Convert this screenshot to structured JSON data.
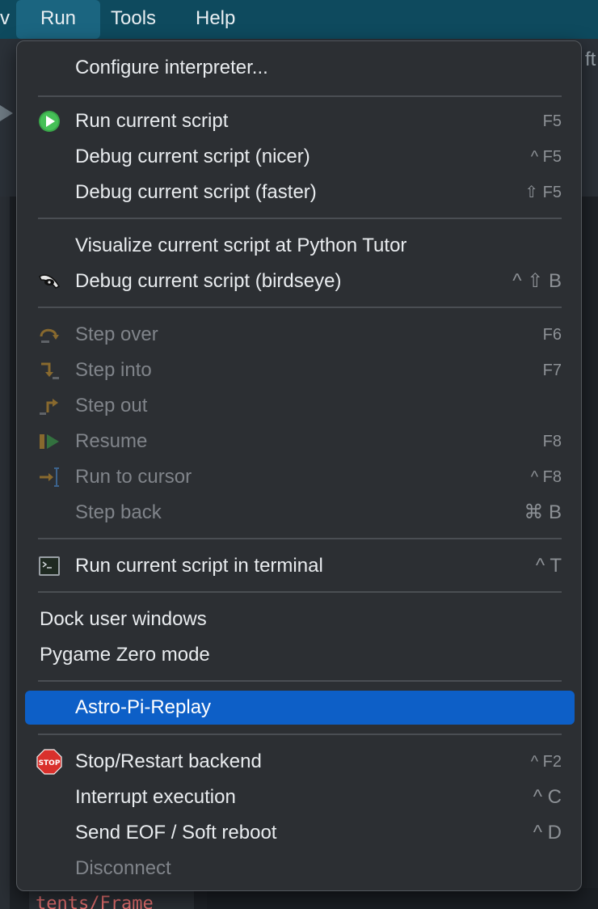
{
  "menubar": {
    "left_fragment": "v",
    "items": [
      "Run",
      "Tools",
      "Help"
    ]
  },
  "background": {
    "right_fragment": "ft",
    "code_fragment": "tents/Frame"
  },
  "menu": {
    "items": [
      {
        "label": "Configure interpreter...",
        "shortcut": "",
        "icon": "",
        "enabled": true
      },
      {
        "label": "Run current script",
        "shortcut": "F5",
        "icon": "run-icon",
        "enabled": true
      },
      {
        "label": "Debug current script (nicer)",
        "shortcut": "^ F5",
        "icon": "",
        "enabled": true
      },
      {
        "label": "Debug current script (faster)",
        "shortcut": "⇧ F5",
        "icon": "",
        "enabled": true
      },
      {
        "label": "Visualize current script at Python Tutor",
        "shortcut": "",
        "icon": "",
        "enabled": true
      },
      {
        "label": "Debug current script (birdseye)",
        "shortcut": "^ ⇧ B",
        "icon": "birdseye-icon",
        "enabled": true
      },
      {
        "label": "Step over",
        "shortcut": "F6",
        "icon": "step-over-icon",
        "enabled": false
      },
      {
        "label": "Step into",
        "shortcut": "F7",
        "icon": "step-into-icon",
        "enabled": false
      },
      {
        "label": "Step out",
        "shortcut": "",
        "icon": "step-out-icon",
        "enabled": false
      },
      {
        "label": "Resume",
        "shortcut": "F8",
        "icon": "resume-icon",
        "enabled": false
      },
      {
        "label": "Run to cursor",
        "shortcut": "^ F8",
        "icon": "run-to-cursor-icon",
        "enabled": false
      },
      {
        "label": "Step back",
        "shortcut": "⌘ B",
        "icon": "",
        "enabled": false
      },
      {
        "label": "Run current script in terminal",
        "shortcut": "^ T",
        "icon": "terminal-icon",
        "enabled": true
      },
      {
        "label": "Dock user windows",
        "shortcut": "",
        "icon": "",
        "enabled": true
      },
      {
        "label": "Pygame Zero mode",
        "shortcut": "",
        "icon": "",
        "enabled": true
      },
      {
        "label": "Astro-Pi-Replay",
        "shortcut": "",
        "icon": "",
        "enabled": true,
        "highlighted": true
      },
      {
        "label": "Stop/Restart backend",
        "shortcut": "^ F2",
        "icon": "stop-icon",
        "enabled": true
      },
      {
        "label": "Interrupt execution",
        "shortcut": "^ C",
        "icon": "",
        "enabled": true
      },
      {
        "label": "Send EOF / Soft reboot",
        "shortcut": "^ D",
        "icon": "",
        "enabled": true
      },
      {
        "label": "Disconnect",
        "shortcut": "",
        "icon": "",
        "enabled": false
      }
    ]
  },
  "colors": {
    "highlight": "#0d5fc7",
    "menubar": "#0e4a5e",
    "menu_bg": "#2c2f33",
    "run_green": "#3aa84a",
    "stop_red": "#d9302c"
  }
}
